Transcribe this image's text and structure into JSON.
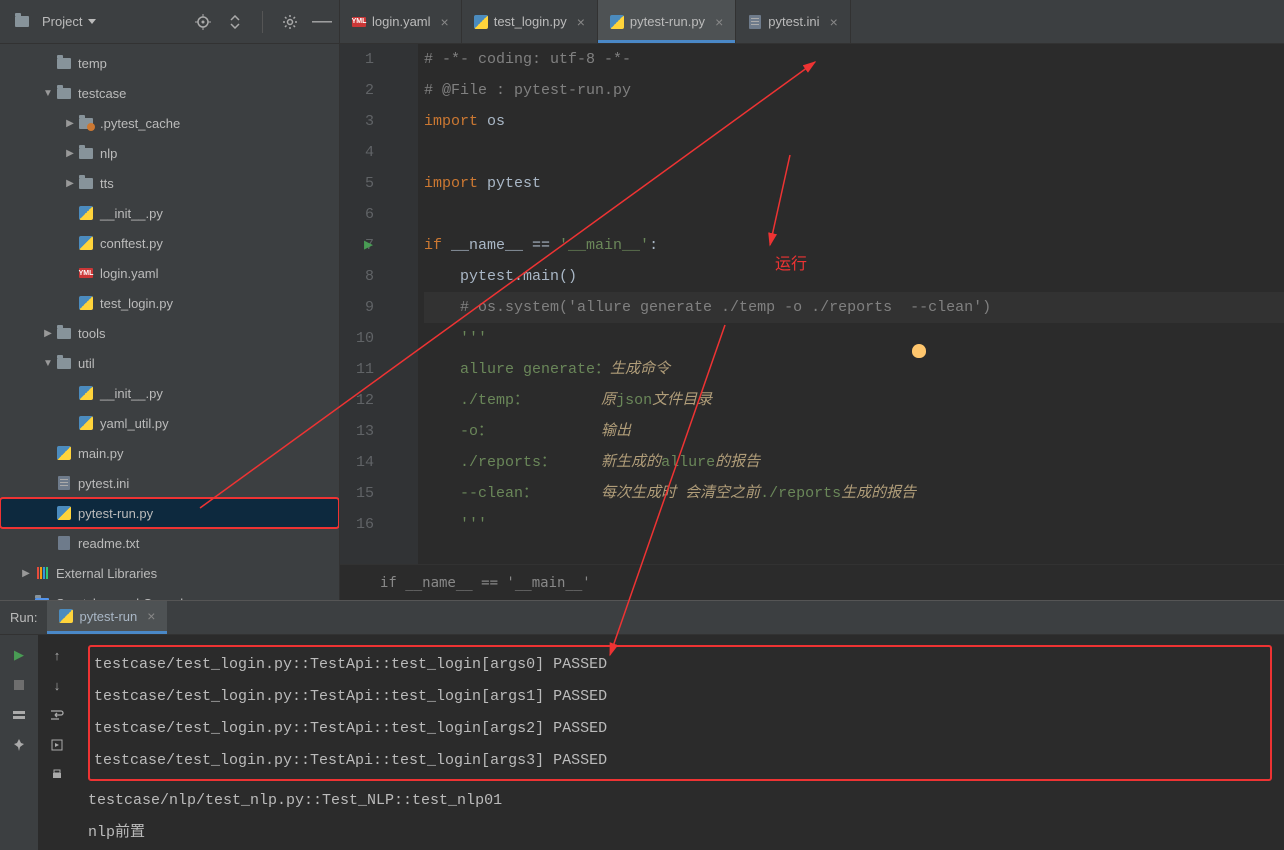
{
  "sidebar": {
    "project_label": "Project",
    "tree": [
      {
        "depth": 1,
        "exp": "",
        "icon": "dir",
        "label": "temp"
      },
      {
        "depth": 1,
        "exp": "▼",
        "icon": "dir",
        "label": "testcase"
      },
      {
        "depth": 2,
        "exp": "▶",
        "icon": "dir-dot",
        "label": ".pytest_cache"
      },
      {
        "depth": 2,
        "exp": "▶",
        "icon": "dir",
        "label": "nlp"
      },
      {
        "depth": 2,
        "exp": "▶",
        "icon": "dir",
        "label": "tts"
      },
      {
        "depth": 2,
        "exp": "",
        "icon": "py",
        "label": "__init__.py"
      },
      {
        "depth": 2,
        "exp": "",
        "icon": "py",
        "label": "conftest.py"
      },
      {
        "depth": 2,
        "exp": "",
        "icon": "yml",
        "label": "login.yaml"
      },
      {
        "depth": 2,
        "exp": "",
        "icon": "py",
        "label": "test_login.py"
      },
      {
        "depth": 1,
        "exp": "▶",
        "icon": "dir",
        "label": "tools"
      },
      {
        "depth": 1,
        "exp": "▼",
        "icon": "dir",
        "label": "util"
      },
      {
        "depth": 2,
        "exp": "",
        "icon": "py",
        "label": "__init__.py"
      },
      {
        "depth": 2,
        "exp": "",
        "icon": "py",
        "label": "yaml_util.py"
      },
      {
        "depth": 1,
        "exp": "",
        "icon": "py",
        "label": "main.py"
      },
      {
        "depth": 1,
        "exp": "",
        "icon": "ini",
        "label": "pytest.ini"
      },
      {
        "depth": 1,
        "exp": "",
        "icon": "py",
        "label": "pytest-run.py",
        "selected": true,
        "highlighted": true
      },
      {
        "depth": 1,
        "exp": "",
        "icon": "txt",
        "label": "readme.txt"
      },
      {
        "depth": 0,
        "exp": "▶",
        "icon": "lib",
        "label": "External Libraries"
      },
      {
        "depth": 0,
        "exp": "",
        "icon": "scr",
        "label": "Scratches and Consoles"
      }
    ]
  },
  "tabs": [
    {
      "icon": "yml",
      "label": "login.yaml",
      "active": false
    },
    {
      "icon": "py",
      "label": "test_login.py",
      "active": false
    },
    {
      "icon": "py",
      "label": "pytest-run.py",
      "active": true
    },
    {
      "icon": "ini",
      "label": "pytest.ini",
      "active": false
    }
  ],
  "editor": {
    "lines": [
      {
        "n": 1,
        "seg": [
          {
            "c": "k-comment",
            "t": "# -*- coding: utf-8 -*-"
          }
        ]
      },
      {
        "n": 2,
        "seg": [
          {
            "c": "k-comment",
            "t": "# @File : pytest-run.py"
          }
        ]
      },
      {
        "n": 3,
        "seg": [
          {
            "c": "k-kw",
            "t": "import "
          },
          {
            "c": "",
            "t": "os"
          }
        ]
      },
      {
        "n": 4,
        "seg": []
      },
      {
        "n": 5,
        "seg": [
          {
            "c": "k-kw",
            "t": "import "
          },
          {
            "c": "",
            "t": "pytest"
          }
        ]
      },
      {
        "n": 6,
        "seg": []
      },
      {
        "n": 7,
        "run": true,
        "seg": [
          {
            "c": "k-kw",
            "t": "if "
          },
          {
            "c": "",
            "t": "__name__ == "
          },
          {
            "c": "k-str",
            "t": "'__main__'"
          },
          {
            "c": "",
            "t": ":"
          }
        ]
      },
      {
        "n": 8,
        "seg": [
          {
            "c": "",
            "t": "    pytest.main()"
          }
        ]
      },
      {
        "n": 9,
        "cur": true,
        "seg": [
          {
            "c": "",
            "t": "    "
          },
          {
            "c": "k-comment",
            "t": "# os.system('allure generate ./temp -o ./reports  --clean')"
          }
        ]
      },
      {
        "n": 10,
        "seg": [
          {
            "c": "",
            "t": "    "
          },
          {
            "c": "k-str",
            "t": "'''"
          }
        ]
      },
      {
        "n": 11,
        "seg": [
          {
            "c": "",
            "t": "    "
          },
          {
            "c": "k-str",
            "t": "allure generate："
          },
          {
            "c": "k-cn",
            "t": "生成命令"
          }
        ]
      },
      {
        "n": 12,
        "seg": [
          {
            "c": "",
            "t": "    "
          },
          {
            "c": "k-str",
            "t": "./temp：        "
          },
          {
            "c": "k-cn",
            "t": "原"
          },
          {
            "c": "k-str",
            "t": "json"
          },
          {
            "c": "k-cn",
            "t": "文件目录"
          }
        ]
      },
      {
        "n": 13,
        "seg": [
          {
            "c": "",
            "t": "    "
          },
          {
            "c": "k-str",
            "t": "-o：            "
          },
          {
            "c": "k-cn",
            "t": "输出"
          }
        ]
      },
      {
        "n": 14,
        "seg": [
          {
            "c": "",
            "t": "    "
          },
          {
            "c": "k-str",
            "t": "./reports：     "
          },
          {
            "c": "k-cn",
            "t": "新生成的"
          },
          {
            "c": "k-str",
            "t": "allure"
          },
          {
            "c": "k-cn",
            "t": "的报告"
          }
        ]
      },
      {
        "n": 15,
        "seg": [
          {
            "c": "",
            "t": "    "
          },
          {
            "c": "k-str",
            "t": "--clean：       "
          },
          {
            "c": "k-cn",
            "t": "每次生成时 会清空之前"
          },
          {
            "c": "k-str",
            "t": "./reports"
          },
          {
            "c": "k-cn",
            "t": "生成的报告"
          }
        ]
      },
      {
        "n": 16,
        "seg": [
          {
            "c": "",
            "t": "    "
          },
          {
            "c": "k-str",
            "t": "'''"
          }
        ]
      }
    ],
    "crumb": "if __name__ == '__main__'"
  },
  "run": {
    "label": "Run:",
    "tab": "pytest-run",
    "console_boxed": [
      "testcase/test_login.py::TestApi::test_login[args0] PASSED",
      "testcase/test_login.py::TestApi::test_login[args1] PASSED",
      "testcase/test_login.py::TestApi::test_login[args2] PASSED",
      "testcase/test_login.py::TestApi::test_login[args3] PASSED"
    ],
    "console_rest": [
      "testcase/nlp/test_nlp.py::Test_NLP::test_nlp01",
      "nlp前置"
    ]
  },
  "annotation": {
    "run_label": "运行"
  }
}
